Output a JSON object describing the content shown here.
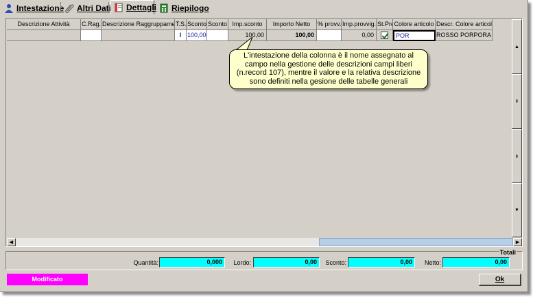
{
  "tabs": [
    {
      "label": "Intestazione",
      "icon": "person-icon"
    },
    {
      "label": "Altri Dati",
      "icon": "paperclip-icon"
    },
    {
      "label": "Dettagli",
      "icon": "notebook-icon",
      "active": true
    },
    {
      "label": "Riepilogo",
      "icon": "calculator-icon"
    }
  ],
  "grid": {
    "columns": [
      "Descrizione Attività",
      "C.Rag.",
      "Descrizione Raggruppamento",
      "T.S.",
      "Sconto",
      "Sconto",
      "Imp.sconto",
      "Importo Netto",
      "% provv.",
      "Imp.provvig.",
      "St.Pre",
      "Colore articolo",
      "Descr. Colore articolo"
    ],
    "row": {
      "descrizione_attivita": "",
      "c_rag": "",
      "descrizione_raggruppamento": "",
      "ts": "I",
      "sconto1": "100,000",
      "sconto2": "",
      "imp_sconto": "100,00",
      "importo_netto": "100,00",
      "perc_provv": "",
      "imp_provvig": "0,00",
      "st_pre_checked": true,
      "colore_articolo": "POR",
      "descr_colore_articolo": "ROSSO PORPORA"
    }
  },
  "callout": {
    "lines": [
      "L'intestazione della colonna è il nome assegnato al",
      "campo nella gestione delle descrizioni campi liberi",
      "(n.record 107), mentre il valore e la relativa descrizione",
      "sono definiti nella gesione delle tabelle generali"
    ]
  },
  "totals": {
    "title": "Totali",
    "quantita_label": "Quantità:",
    "quantita_value": "0,000",
    "lordo_label": "Lordo:",
    "lordo_value": "0,00",
    "sconto_label": "Sconto:",
    "sconto_value": "0,00",
    "netto_label": "Netto:",
    "netto_value": "0,00"
  },
  "status": {
    "label": "Modificato",
    "color": "#ff00ff"
  },
  "ok_button": {
    "label": "Ok"
  },
  "colors": {
    "total_field": "#00ffff",
    "callout_bg": "#ffffcc",
    "window_bg": "#d4d0c8"
  }
}
